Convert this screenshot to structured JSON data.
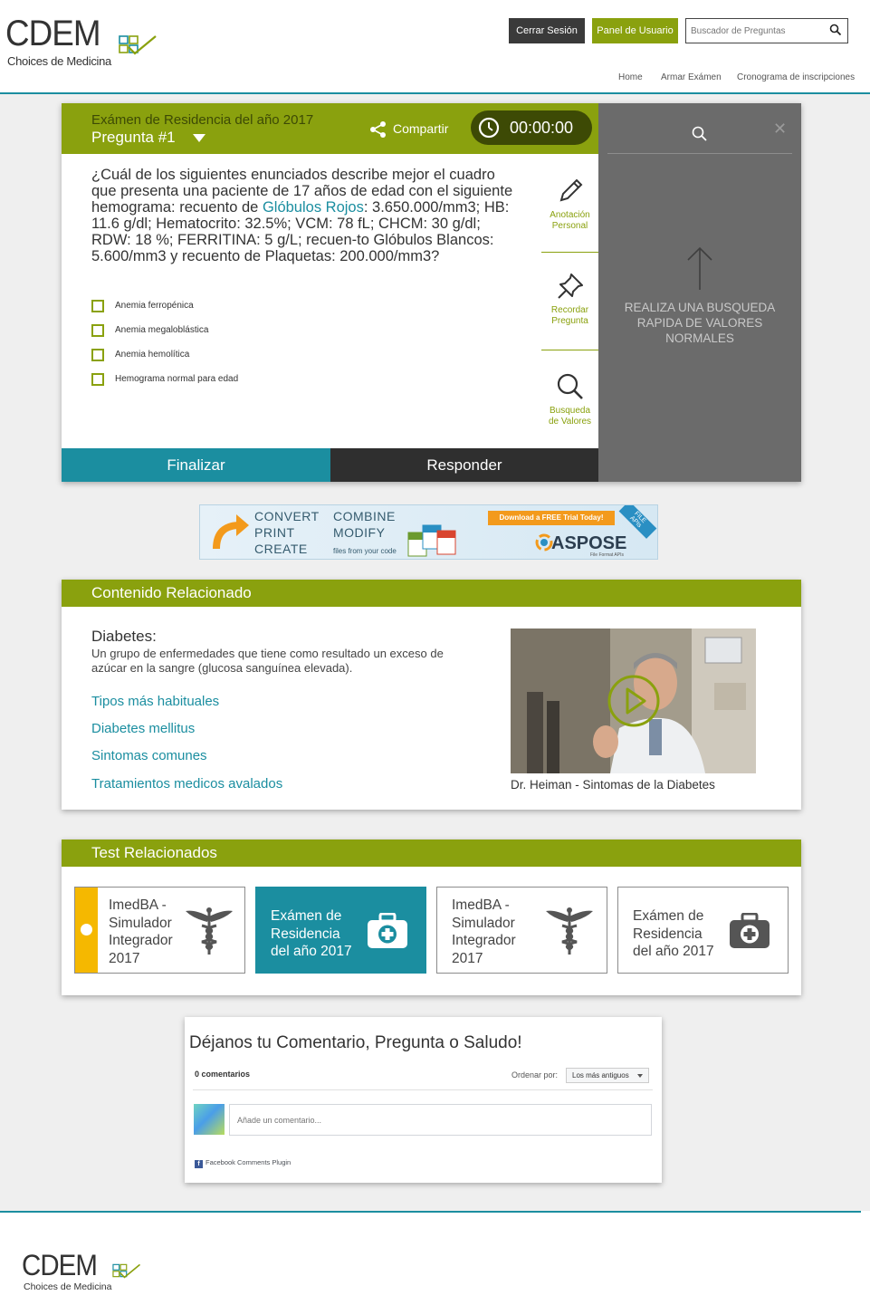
{
  "header": {
    "logo_text": "CDEM",
    "logo_subtitle": "Choices de Medicina",
    "logout_label": "Cerrar Sesión",
    "panel_label": "Panel de Usuario",
    "search_placeholder": "Buscador de Preguntas",
    "nav": [
      "Home",
      "Armar Exámen",
      "Cronograma de inscripciones"
    ]
  },
  "question": {
    "exam_title": "Exámen de Residencia del año 2017",
    "number_label": "Pregunta #1",
    "share_label": "Compartir",
    "timer": "00:00:00",
    "text_before": "¿Cuál de los siguientes enunciados describe mejor el cuadro que presenta una paciente de 17 años de edad con el siguiente hemograma: recuento de ",
    "text_highlight": "Glóbulos Rojos",
    "text_after": ": 3.650.000/mm3; HB: 11.6 g/dl; Hematocrito: 32.5%; VCM: 78 fL; CHCM: 30 g/dl; RDW: 18 %; FERRITINA: 5 g/L; recuen-to Glóbulos Blancos: 5.600/mm3 y recuento de Plaquetas: 200.000/mm3?",
    "options": [
      "Anemia ferropénica",
      "Anemia megaloblástica",
      "Anemia hemolítica",
      "Hemograma normal para edad"
    ],
    "tools": {
      "note_line1": "Anotación",
      "note_line2": "Personal",
      "remember_line1": "Recordar",
      "remember_line2": "Pregunta",
      "search_line1": "Busqueda",
      "search_line2": "de Valores"
    },
    "finish_label": "Finalizar",
    "answer_label": "Responder",
    "side_panel_msg": "REALIZA UNA BUSQUEDA RAPIDA DE VALORES NORMALES"
  },
  "ad": {
    "col1": [
      "CONVERT",
      "PRINT",
      "CREATE"
    ],
    "col2": [
      "COMBINE",
      "MODIFY"
    ],
    "col2_small": "files from your code",
    "trial": "Download a FREE Trial Today!",
    "brand": "ASPOSE",
    "brand_sub": "File Format APIs",
    "ribbon": "FILE APIs"
  },
  "related": {
    "header": "Contenido Relacionado",
    "title": "Diabetes:",
    "description": "Un grupo de enfermedades que tiene como resultado un exceso de azúcar en la sangre (glucosa sanguínea elevada).",
    "links": [
      "Tipos más habituales",
      "Diabetes mellitus",
      "Sintomas comunes",
      "Tratamientos medicos avalados"
    ],
    "video_caption": "Dr. Heiman - Sintomas de la Diabetes"
  },
  "tests": {
    "header": "Test Relacionados",
    "tiles": [
      {
        "lines": [
          "ImedBA -",
          "Simulador",
          "Integrador",
          "2017"
        ]
      },
      {
        "lines": [
          "Exámen de",
          "Residencia",
          "del año 2017"
        ]
      },
      {
        "lines": [
          "ImedBA -",
          "Simulador",
          "Integrador",
          "2017"
        ]
      },
      {
        "lines": [
          "Exámen de",
          "Residencia",
          "del año 2017"
        ]
      }
    ]
  },
  "comments": {
    "title": "Déjanos tu Comentario, Pregunta o Saludo!",
    "count": "0 comentarios",
    "order_label": "Ordenar por:",
    "order_value": "Los más antiguos",
    "placeholder": "Añade un comentario...",
    "plugin": "Facebook Comments Plugin"
  },
  "footer": {
    "logo_text": "CDEM",
    "logo_subtitle": "Choices de Medicina"
  },
  "colors": {
    "accent_green": "#8aa10e",
    "dark_green": "#3d4a05",
    "teal": "#1b8ea0",
    "dark": "#2f2f2f",
    "panel_grey": "#6b6b6b"
  }
}
